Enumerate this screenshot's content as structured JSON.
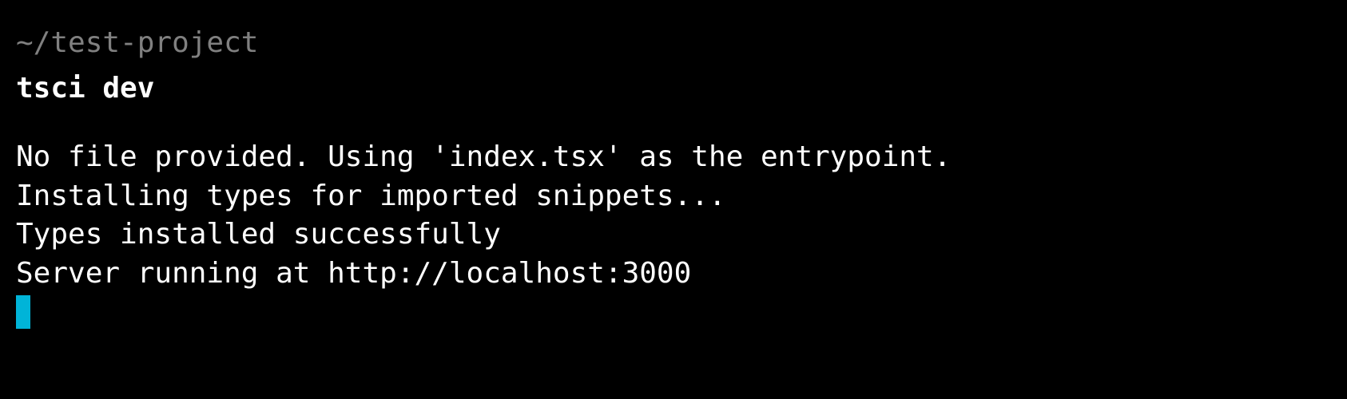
{
  "terminal": {
    "prompt_path": "~/test-project",
    "command": "tsci dev",
    "output": [
      "No file provided. Using 'index.tsx' as the entrypoint.",
      "Installing types for imported snippets...",
      "Types installed successfully",
      "Server running at http://localhost:3000"
    ]
  }
}
